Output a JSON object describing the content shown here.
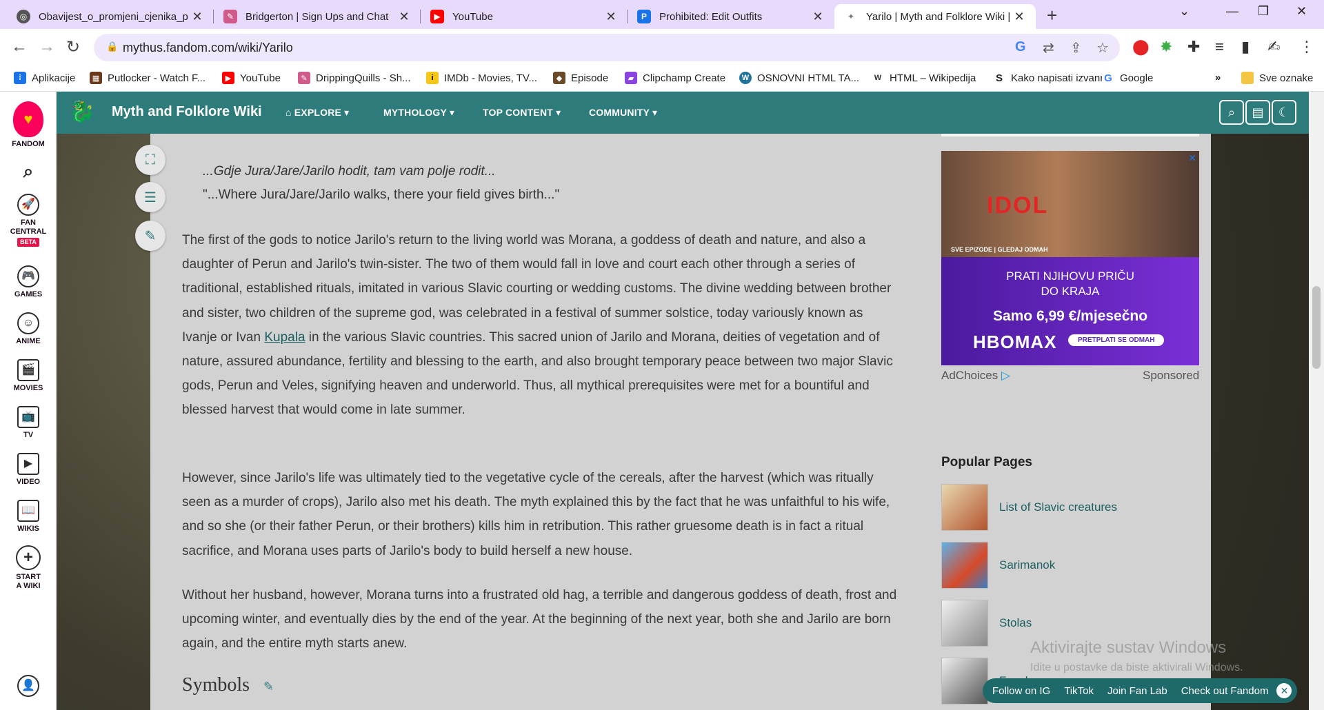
{
  "browser": {
    "tabs": [
      {
        "title": "Obavijest_o_promjeni_cjenika_p",
        "icon": "chrome-icon",
        "color": "#555555"
      },
      {
        "title": "Bridgerton | Sign Ups and Chat",
        "icon": "quill-icon",
        "color": "#d05a8a"
      },
      {
        "title": "YouTube",
        "icon": "youtube-icon",
        "color": "#ff0000"
      },
      {
        "title": "Prohibited: Edit Outfits",
        "icon": "p-icon",
        "color": "#1a73e8"
      },
      {
        "title": "Yarilo | Myth and Folklore Wiki |",
        "icon": "wiki-icon",
        "color": "#7a7a7a"
      }
    ],
    "url": "mythus.fandom.com/wiki/Yarilo",
    "bookmarks": [
      {
        "label": "Aplikacije",
        "color": "#1a73e8"
      },
      {
        "label": "Putlocker - Watch F...",
        "color": "#6b3a1c"
      },
      {
        "label": "YouTube",
        "color": "#ff0000"
      },
      {
        "label": "DrippingQuills - Sh...",
        "color": "#d05a8a"
      },
      {
        "label": "IMDb - Movies, TV...",
        "color": "#f5c518"
      },
      {
        "label": "Episode",
        "color": "#6b4a2a"
      },
      {
        "label": "Clipchamp Create",
        "color": "#8a44e0"
      },
      {
        "label": "OSNOVNI HTML TA...",
        "color": "#21759b"
      },
      {
        "label": "HTML – Wikipedija",
        "color": "#333333"
      },
      {
        "label": "Kako napisati izvanr...",
        "color": "#222222"
      },
      {
        "label": "Google",
        "color": "#4285f4"
      },
      {
        "label": "Sve oznake",
        "color": "#f4c542"
      }
    ],
    "more_bookmarks": "»"
  },
  "fandom_rail": {
    "brand": "FANDOM",
    "items": [
      {
        "label": "",
        "icon": "search-icon"
      },
      {
        "label": "FAN CENTRAL",
        "icon": "rocket-icon",
        "badge": "BETA"
      },
      {
        "label": "GAMES",
        "icon": "controller-icon"
      },
      {
        "label": "ANIME",
        "icon": "anime-icon"
      },
      {
        "label": "MOVIES",
        "icon": "clapper-icon"
      },
      {
        "label": "TV",
        "icon": "tv-icon"
      },
      {
        "label": "VIDEO",
        "icon": "play-icon"
      },
      {
        "label": "WIKIS",
        "icon": "book-icon"
      },
      {
        "label": "START A WIKI",
        "icon": "plus-icon"
      }
    ]
  },
  "wiki_header": {
    "name": "Myth and Folklore Wiki",
    "nav": [
      "EXPLORE",
      "MYTHOLOGY",
      "TOP CONTENT",
      "COMMUNITY"
    ]
  },
  "article": {
    "quote_native": "...Gdje Jura/Jare/Jarilo hodit, tam vam polje rodit...",
    "quote_english": "\"...Where Jura/Jare/Jarilo walks, there your field gives birth...\"",
    "para1_a": "The first of the gods to notice Jarilo's return to the living world was Morana, a goddess of death and nature, and also a daughter of Perun and Jarilo's twin-sister. The two of them would fall in love and court each other through a series of traditional, established rituals, imitated in various Slavic courting or wedding customs. The divine wedding between brother and sister, two children of the supreme god, was celebrated in a festival of summer solstice, today variously known as Ivanje or Ivan ",
    "para1_link": "Kupala",
    "para1_b": " in the various Slavic countries. This sacred union of Jarilo and Morana, deities of vegetation and of nature, assured abundance, fertility and blessing to the earth, and also brought temporary peace between two major Slavic gods, Perun and Veles, signifying heaven and underworld. Thus, all mythical prerequisites were met for a bountiful and blessed harvest that would come in late summer.",
    "para2": "However, since Jarilo's life was ultimately tied to the vegetative cycle of the cereals, after the harvest (which was ritually seen as a murder of crops), Jarilo also met his death. The myth explained this by the fact that he was unfaithful to his wife, and so she (or their father Perun, or their brothers) kills him in retribution. This rather gruesome death is in fact a ritual sacrifice, and Morana uses parts of Jarilo's body to build herself a new house.",
    "para3": "Without her husband, however, Morana turns into a frustrated old hag, a terrible and dangerous goddess of death, frost and upcoming winter, and eventually dies by the end of the year. At the beginning of the next year, both she and Jarilo are born again, and the entire myth starts anew.",
    "section_heading": "Symbols"
  },
  "ad": {
    "headline": "IDOL",
    "small_text": "SVE EPIZODE | GLEDAJ ODMAH",
    "line1": "PRATI NJIHOVU PRIČU",
    "line2": "DO KRAJA",
    "price": "Samo 6,99 €/mjesečno",
    "brand": "HBOMAX",
    "cta": "PRETPLATI SE ODMAH",
    "adchoices": "AdChoices",
    "sponsored": "Sponsored"
  },
  "popular_pages": {
    "title": "Popular Pages",
    "items": [
      {
        "label": "List of Slavic creatures",
        "color": "#b3542d"
      },
      {
        "label": "Sarimanok",
        "color": "#3a7fc4"
      },
      {
        "label": "Stolas",
        "color": "#8a8a8a"
      },
      {
        "label": "Focalor",
        "color": "#6a6a6a"
      }
    ]
  },
  "watermark": {
    "line1": "Aktivirajte sustav Windows",
    "line2": "Idite u postavke da biste aktivirali Windows."
  },
  "bottom_bar": [
    "Follow on IG",
    "TikTok",
    "Join Fan Lab",
    "Check out Fandom"
  ]
}
